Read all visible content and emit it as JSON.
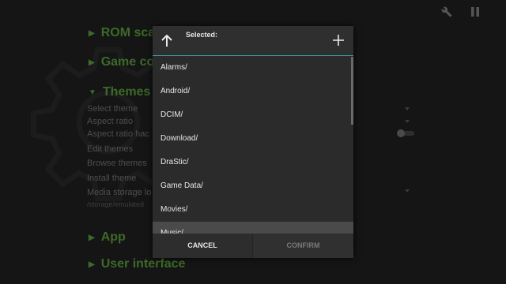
{
  "settings": {
    "sections": {
      "rom_scan": "ROM sca",
      "game_controls": "Game co",
      "themes": "Themes",
      "app": "App",
      "user_interface": "User interface"
    },
    "items": {
      "select_theme": "Select theme",
      "aspect_ratio": "Aspect ratio",
      "aspect_ratio_hack": "Aspect ratio hac",
      "edit_themes": "Edit themes",
      "browse_themes": "Browse themes",
      "install_theme": "Install theme",
      "media_storage": "Media storage lo",
      "media_storage_path": "/storage/emulated"
    }
  },
  "top_icons": [
    "wrench-icon",
    "pause-icon"
  ],
  "dialog": {
    "selected_label": "Selected:",
    "files": [
      "Alarms/",
      "Android/",
      "DCIM/",
      "Download/",
      "DraStic/",
      "Game Data/",
      "Movies/",
      "Music/"
    ],
    "cancel_label": "CANCEL",
    "confirm_label": "CONFIRM"
  },
  "colors": {
    "accent_green": "#3c6a28",
    "divider_teal": "#3e9aa6",
    "dialog_bg": "#2b2b2b"
  }
}
